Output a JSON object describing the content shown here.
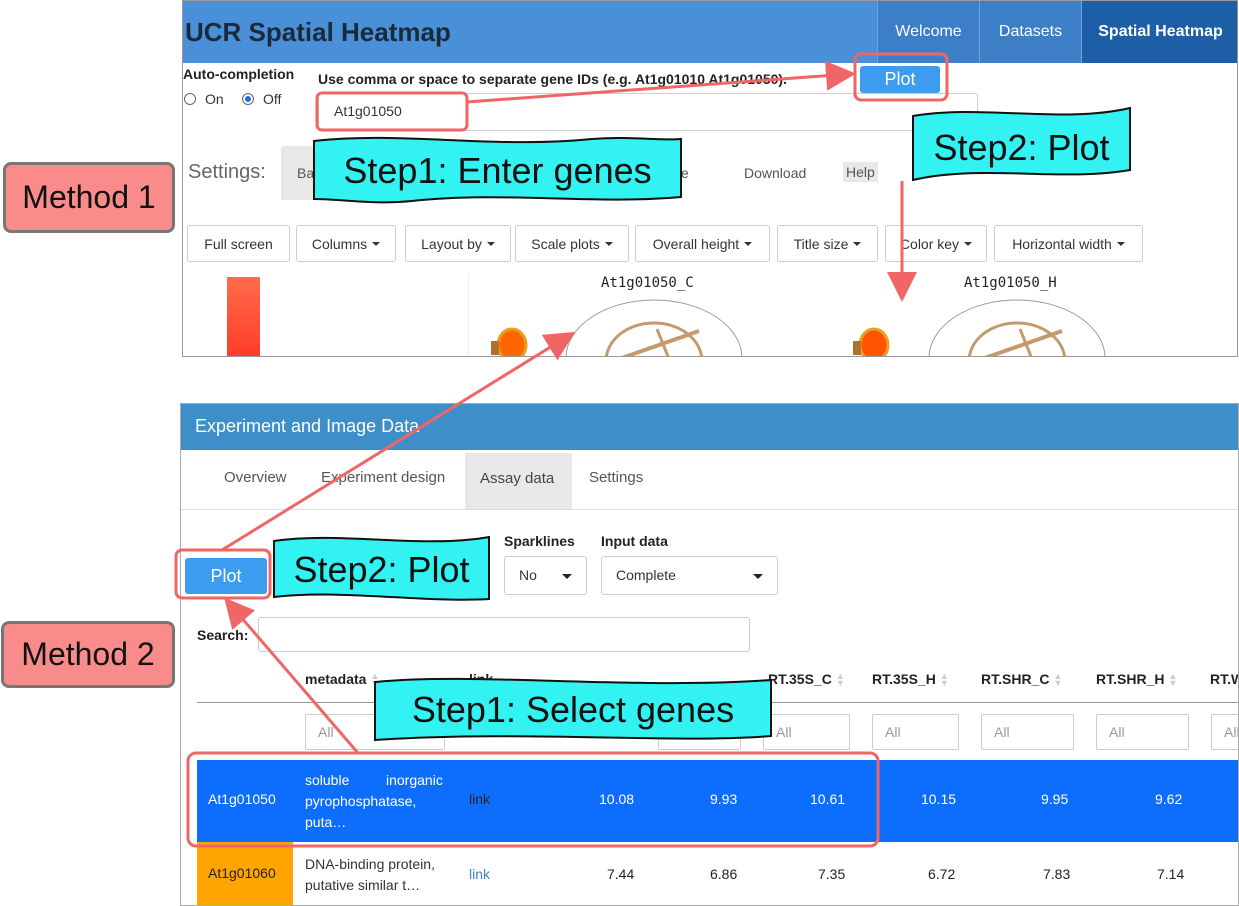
{
  "colors": {
    "highlight": "#f06666",
    "callout_fill": "#33f2f2",
    "method_fill": "#f98b8b",
    "selected_row": "#0d6efd",
    "orange_cell": "#ffa500",
    "primary_button": "#3b9cf0"
  },
  "annotations": {
    "method1": "Method 1",
    "method2": "Method 2",
    "step1_top": "Step1: Enter genes",
    "step2_top": "Step2: Plot",
    "step2_bottom": "Step2: Plot",
    "step1_bottom": "Step1: Select genes"
  },
  "top": {
    "app_title": "UCR Spatial Heatmap",
    "nav": {
      "welcome": "Welcome",
      "datasets": "Datasets",
      "spatial": "Spatial Heatmap"
    },
    "autocompletion": {
      "label": "Auto-completion",
      "on": "On",
      "off": "Off",
      "selected": "Off"
    },
    "gene_help": "Use comma or space to separate gene IDs (e.g. At1g01010 At1g01050).",
    "gene_input_value": "At1g01050",
    "plot_button": "Plot",
    "settings": {
      "label": "Settings:",
      "tab_basic": "Ba",
      "tab_outline": "tline",
      "tab_download": "Download",
      "tab_help": "Help"
    },
    "toolbar": {
      "full_screen": "Full screen",
      "columns": "Columns",
      "layout_by": "Layout by",
      "scale_plots": "Scale plots",
      "overall_height": "Overall height",
      "title_size": "Title size",
      "color_key": "Color key",
      "horizontal_width": "Horizontal width"
    },
    "plot_titles": {
      "c": "At1g01050_C",
      "h": "At1g01050_H"
    }
  },
  "bottom": {
    "panel_title": "Experiment and Image Data",
    "tabs": {
      "overview": "Overview",
      "design": "Experiment design",
      "assay": "Assay data",
      "settings": "Settings"
    },
    "plot_button": "Plot",
    "sparklines": {
      "label": "Sparklines",
      "value": "No"
    },
    "input_data": {
      "label": "Input data",
      "value": "Complete"
    },
    "search_label": "Search:",
    "table": {
      "headers": {
        "metadata": "metadata",
        "link": "link",
        "c3": "RT.35S_C",
        "c4": "RT.35S_H",
        "c5": "RT.SHR_C",
        "c6": "RT.SHR_H",
        "c7": "RT.W"
      },
      "filter_placeholder": "All",
      "rows": [
        {
          "gene": "At1g01050",
          "meta_1": "soluble",
          "meta_1b": "inorganic",
          "meta_2": "pyrophosphatase,",
          "meta_3": "puta…",
          "link": "link",
          "v1": "10.08",
          "v2": "9.93",
          "v3": "10.61",
          "v4": "10.15",
          "v5": "9.95",
          "v6": "9.62"
        },
        {
          "gene": "At1g01060",
          "meta_1": "DNA-binding protein,",
          "meta_2": "putative similar t…",
          "link": "link",
          "v1": "7.44",
          "v2": "6.86",
          "v3": "7.35",
          "v4": "6.72",
          "v5": "7.83",
          "v6": "7.14"
        }
      ]
    }
  }
}
